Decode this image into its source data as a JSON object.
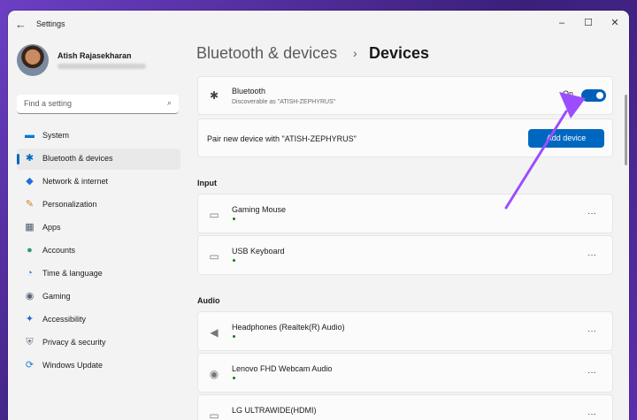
{
  "window": {
    "app_title": "Settings",
    "back_icon": "←",
    "controls": {
      "minimize": "–",
      "maximize": "☐",
      "close": "✕"
    }
  },
  "profile": {
    "name": "Atish Rajasekharan"
  },
  "search": {
    "placeholder": "Find a setting",
    "icon": "⌕"
  },
  "sidebar": {
    "items": [
      {
        "label": "System",
        "icon": "▬",
        "color": "#0078d4",
        "active": false
      },
      {
        "label": "Bluetooth & devices",
        "icon": "✱",
        "color": "#0067c0",
        "active": true
      },
      {
        "label": "Network & internet",
        "icon": "◆",
        "color": "#1e6fd9",
        "active": false
      },
      {
        "label": "Personalization",
        "icon": "✎",
        "color": "#d07a2a",
        "active": false
      },
      {
        "label": "Apps",
        "icon": "▦",
        "color": "#4a5a70",
        "active": false
      },
      {
        "label": "Accounts",
        "icon": "●",
        "color": "#2c9a6b",
        "active": false
      },
      {
        "label": "Time & language",
        "icon": "◔",
        "color": "#1e7fd0",
        "active": false
      },
      {
        "label": "Gaming",
        "icon": "◉",
        "color": "#5a6470",
        "active": false
      },
      {
        "label": "Accessibility",
        "icon": "✦",
        "color": "#1b6ad0",
        "active": false
      },
      {
        "label": "Privacy & security",
        "icon": "⛨",
        "color": "#6a7482",
        "active": false
      },
      {
        "label": "Windows Update",
        "icon": "⟳",
        "color": "#1e7fd0",
        "active": false
      }
    ]
  },
  "breadcrumb": {
    "parent": "Bluetooth & devices",
    "separator": "›",
    "current": "Devices"
  },
  "bluetooth": {
    "title": "Bluetooth",
    "subtitle": "Discoverable as \"ATISH-ZEPHYRUS\"",
    "state_label": "On",
    "enabled": true
  },
  "pair": {
    "text": "Pair new device with \"ATISH-ZEPHYRUS\"",
    "button_label": "Add device"
  },
  "sections": {
    "input_label": "Input",
    "audio_label": "Audio"
  },
  "input_devices": [
    {
      "name": "Gaming Mouse",
      "more": "···"
    },
    {
      "name": "USB Keyboard",
      "more": "···"
    }
  ],
  "audio_devices": [
    {
      "name": "Headphones (Realtek(R) Audio)",
      "more": "···"
    },
    {
      "name": "Lenovo FHD Webcam Audio",
      "more": "···"
    },
    {
      "name": "LG ULTRAWIDE(HDMI)",
      "more": "···"
    }
  ],
  "colors": {
    "accent": "#0067c0",
    "annotation_arrow": "#9b4dff"
  }
}
